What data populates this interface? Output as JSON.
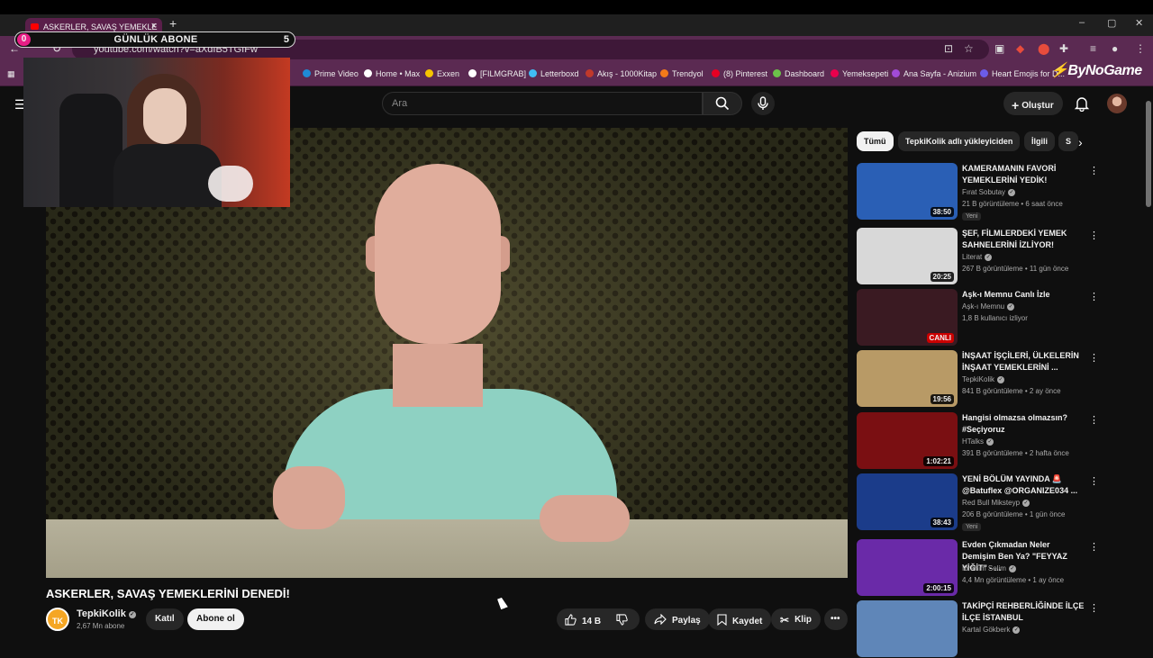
{
  "browser": {
    "tab_title": "ASKERLER, SAVAŞ YEMEKLE",
    "url": "youtube.com/watch?v=aXdIB5TGIFw",
    "bookmarks": [
      {
        "label": "Prime Video",
        "color": "#1f8bd6"
      },
      {
        "label": "Home • Max",
        "color": "#ffffff"
      },
      {
        "label": "Exxen",
        "color": "#f5c400"
      },
      {
        "label": "[FILMGRAB]",
        "color": "#ffffff"
      },
      {
        "label": "Letterboxd",
        "color": "#40bcf4"
      },
      {
        "label": "Akış - 1000Kitap",
        "color": "#c0392b"
      },
      {
        "label": "Trendyol",
        "color": "#f27a1a"
      },
      {
        "label": "(8) Pinterest",
        "color": "#e60023"
      },
      {
        "label": "Dashboard",
        "color": "#6cc24a"
      },
      {
        "label": "Yemeksepeti",
        "color": "#e8004c"
      },
      {
        "label": "Ana Sayfa - Anizium",
        "color": "#a14bd6"
      },
      {
        "label": "Heart Emojis for D...",
        "color": "#6c5ce7"
      }
    ]
  },
  "overlay": {
    "counter_left": "0",
    "title": "GÜNLÜK ABONE",
    "counter_right": "5",
    "watermark": "ByNoGame"
  },
  "header": {
    "search_placeholder": "Ara",
    "create_label": "Oluştur"
  },
  "video": {
    "title": "ASKERLER, SAVAŞ YEMEKLERİNİ DENEDİ!",
    "channel": "TepkiKolik",
    "channel_initials": "TK",
    "subscribers": "2,67 Mn abone",
    "join_label": "Katıl",
    "subscribe_label": "Abone ol",
    "likes": "14 B",
    "share_label": "Paylaş",
    "save_label": "Kaydet",
    "clip_label": "Klip"
  },
  "chips": [
    "Tümü",
    "TepkiKolik adlı yükleyiciden",
    "İlgili",
    "S"
  ],
  "recommendations": [
    {
      "title": "KAMERAMANIN FAVORİ YEMEKLERİNİ YEDİK!",
      "channel": "Fırat Sobutay",
      "meta": "21 B görüntüleme • 6 saat önce",
      "duration": "38:50",
      "badge": "Yeni",
      "thumb_color": "#2a5fb5"
    },
    {
      "title": "ŞEF, FİLMLERDEKİ YEMEK SAHNELERİNİ İZLİYOR!",
      "channel": "Literat",
      "meta": "267 B görüntüleme • 11 gün önce",
      "duration": "20:25",
      "badge": "",
      "thumb_color": "#d8d8d8"
    },
    {
      "title": "Aşk-ı Memnu Canlı İzle",
      "channel": "Aşk-ı Memnu",
      "meta": "1,8 B kullanıcı izliyor",
      "duration": "CANLI",
      "badge": "",
      "thumb_color": "#3a1a22"
    },
    {
      "title": "İNŞAAT İŞÇİLERİ, ÜLKELERİN İNŞAAT YEMEKLERİNİ ...",
      "channel": "TepkiKolik",
      "meta": "841 B görüntüleme • 2 ay önce",
      "duration": "19:56",
      "badge": "",
      "thumb_color": "#b89a66"
    },
    {
      "title": "Hangisi olmazsa olmazsın? #Seçiyoruz",
      "channel": "HTalks",
      "meta": "391 B görüntüleme • 2 hafta önce",
      "duration": "1:02:21",
      "badge": "",
      "thumb_color": "#7a0f12"
    },
    {
      "title": "YENİ BÖLÜM YAYINDA 🚨 @Batuflex @ORGANIZE034 ...",
      "channel": "Red Bull Mikstеyp",
      "meta": "206 B görüntüleme • 1 gün önce",
      "duration": "38:43",
      "badge": "Yeni",
      "thumb_color": "#1b3c8a"
    },
    {
      "title": "Evden Çıkmadan Neler Demişim Ben Ya? \"FEYYAZ YİĞİT\" - ...",
      "channel": "İbrahim Selim",
      "meta": "4,4 Mn görüntüleme • 1 ay önce",
      "duration": "2:00:15",
      "badge": "",
      "thumb_color": "#6a2aa8"
    },
    {
      "title": "TAKİPÇİ REHBERLİĞİNDE İLÇE İLÇE İSTANBUL",
      "channel": "Kartal Gökberk",
      "meta": "",
      "duration": "",
      "badge": "",
      "thumb_color": "#5f86b8"
    }
  ]
}
